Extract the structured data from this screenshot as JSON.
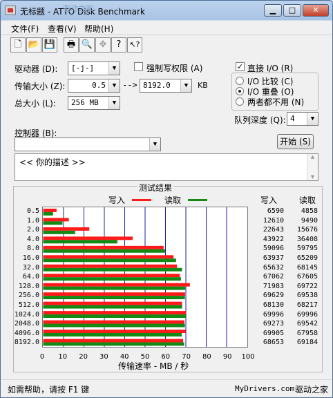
{
  "window": {
    "title": "ATTO Disk Benchmark",
    "title_overlay": "驱动之家",
    "title_prefix": "无标题 -",
    "buttons": {
      "minimize": "▁",
      "maximize": "□",
      "close": "✕"
    }
  },
  "menu": [
    {
      "label": "文件(F)"
    },
    {
      "label": "查看(V)"
    },
    {
      "label": "帮助(H)"
    }
  ],
  "toolbar": {
    "new": "🗋",
    "open": "📂",
    "save": "💾",
    "print": "🖶",
    "preview": "🔍",
    "move": "✥",
    "help": "?",
    "context_help": "↖?"
  },
  "settings": {
    "drive_label": "驱动器 (D):",
    "drive_value": "[-j-]",
    "transfer_label": "传输大小 (Z):",
    "transfer_from": "0.5",
    "transfer_arrow": "-->",
    "transfer_to": "8192.0",
    "transfer_unit": "KB",
    "total_label": "总大小 (L):",
    "total_value": "256 MB",
    "force_write_label": "强制写权限 (A)",
    "force_write_checked": false,
    "controller_label": "控制器 (B):",
    "controller_value": ""
  },
  "io_group": {
    "direct_io_label": "直接 I/O (R)",
    "direct_io_checked": true,
    "options": [
      {
        "label": "I/O 比较 (C)",
        "selected": false
      },
      {
        "label": "I/O 重叠 (O)",
        "selected": true
      },
      {
        "label": "两者都不用 (N)",
        "selected": false
      }
    ],
    "queue_label": "队列深度 (Q):",
    "queue_value": "4"
  },
  "start_button": "开始 (S)",
  "description": "<<   你的描述   >>",
  "results": {
    "title": "测试结果",
    "legend_write": "写入",
    "legend_read": "读取",
    "col_write": "写入",
    "col_read": "读取",
    "write_color": "#ff1a1a",
    "read_color": "#138a13",
    "x_axis_label": "传输速率 - MB / 秒"
  },
  "chart_data": {
    "type": "bar",
    "orientation": "horizontal",
    "categories": [
      "0.5",
      "1.0",
      "2.0",
      "4.0",
      "8.0",
      "16.0",
      "32.0",
      "64.0",
      "128.0",
      "256.0",
      "512.0",
      "1024.0",
      "2048.0",
      "4096.0",
      "8192.0"
    ],
    "series": [
      {
        "name": "写入",
        "values": [
          6590,
          12610,
          22643,
          43922,
          59096,
          63937,
          65632,
          67062,
          71983,
          69629,
          68130,
          69996,
          69273,
          69905,
          68653
        ]
      },
      {
        "name": "读取",
        "values": [
          4858,
          9490,
          15676,
          36408,
          59795,
          65209,
          68145,
          67605,
          69722,
          69538,
          68217,
          69996,
          69542,
          67958,
          69184
        ]
      }
    ],
    "xlabel": "传输速率 - MB / 秒",
    "x_ticks": [
      "0",
      "10",
      "20",
      "30",
      "40",
      "50",
      "60",
      "70",
      "80",
      "90",
      "100"
    ],
    "xlim": [
      0,
      100
    ],
    "value_unit": "KB/s",
    "grid": true
  },
  "statusbar": {
    "help_text": "如需帮助，请按 F1 键",
    "brand": "MyDrivers.com",
    "brand_cn": "驱动之家"
  }
}
